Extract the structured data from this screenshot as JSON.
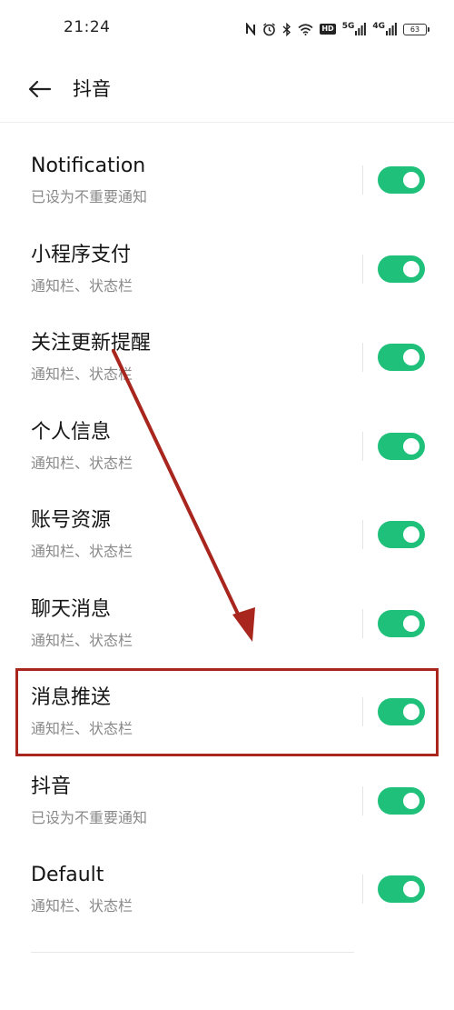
{
  "status_bar": {
    "time": "21:24",
    "network_1": "5G",
    "network_2": "4G",
    "hd_label": "HD",
    "battery": "63",
    "icons": [
      "nfc-icon",
      "alarm-icon",
      "bluetooth-icon",
      "wifi-icon",
      "hd-icon",
      "signal-icon",
      "battery-icon"
    ]
  },
  "header": {
    "back_icon": "back-arrow-icon",
    "title": "抖音"
  },
  "channels": [
    {
      "title": "Notification",
      "subtitle": "已设为不重要通知",
      "enabled": true
    },
    {
      "title": "小程序支付",
      "subtitle": "通知栏、状态栏",
      "enabled": true
    },
    {
      "title": "关注更新提醒",
      "subtitle": "通知栏、状态栏",
      "enabled": true
    },
    {
      "title": "个人信息",
      "subtitle": "通知栏、状态栏",
      "enabled": true
    },
    {
      "title": "账号资源",
      "subtitle": "通知栏、状态栏",
      "enabled": true
    },
    {
      "title": "聊天消息",
      "subtitle": "通知栏、状态栏",
      "enabled": true
    },
    {
      "title": "消息推送",
      "subtitle": "通知栏、状态栏",
      "enabled": true
    },
    {
      "title": "抖音",
      "subtitle": "已设为不重要通知",
      "enabled": true
    },
    {
      "title": "Default",
      "subtitle": "通知栏、状态栏",
      "enabled": true
    }
  ],
  "colors": {
    "toggle_on": "#1ec07a",
    "annotation": "#a8261d"
  },
  "annotation": {
    "highlighted_channel": "消息推送"
  }
}
